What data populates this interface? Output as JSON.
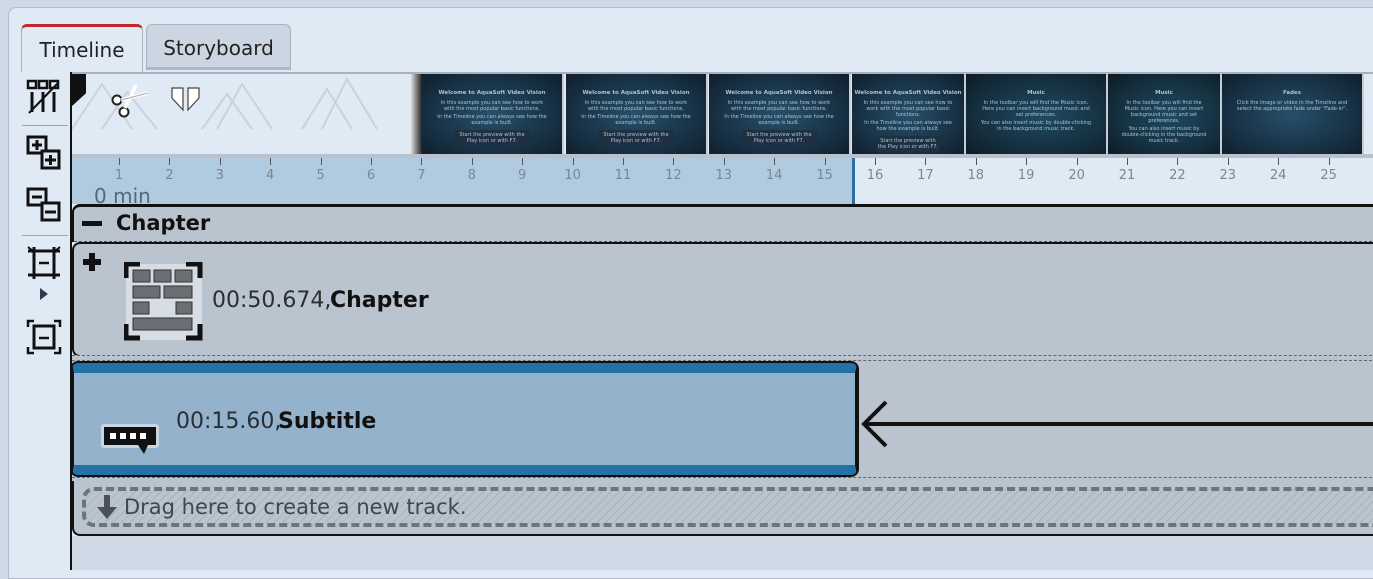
{
  "tabs": [
    {
      "label": "Timeline",
      "active": true
    },
    {
      "label": "Storyboard",
      "active": false
    }
  ],
  "toolstrip": [
    {
      "icon": "trim-tracks-icon"
    },
    {
      "icon": "expand-all-icon"
    },
    {
      "icon": "collapse-all-icon"
    },
    {
      "icon": "zoom-fit-icon"
    },
    {
      "icon": "play-marker-icon"
    },
    {
      "icon": "zoom-out-icon"
    }
  ],
  "toolbar_icons": [
    "scissors-icon",
    "split-marker-icon"
  ],
  "filmstrip": [
    {
      "title": "Welcome to AquaSoft Video Vision",
      "lines": [
        "In this example you can see how to work with the most popular basic functions.",
        "In the Timeline you can always see how the example is built."
      ],
      "box": "Start the preview with the Play icon or with F7."
    },
    {
      "title": "Welcome to AquaSoft Video Vision",
      "lines": [
        "In this example you can see how to work with the most popular basic functions.",
        "In the Timeline you can always see how the example is built."
      ],
      "box": "Start the preview with the Play icon or with F7."
    },
    {
      "title": "Welcome to AquaSoft Video Vision",
      "lines": [
        "In this example you can see how to work with the most popular basic functions.",
        "In the Timeline you can always see how the example is built."
      ],
      "box": "Start the preview with the Play icon or with F7."
    },
    {
      "title": "Welcome to AquaSoft Video Vision",
      "lines": [
        "In this example you can see how to work with the most popular basic functions.",
        "In the Timeline you can always see how the example is built."
      ],
      "box": "Start the preview with the Play icon or with F7."
    },
    {
      "title": "Music",
      "lines": [
        "In the toolbar you will find the Music icon. Here you can insert background music and set preferences.",
        "You can also insert music by double-clicking in the background music track."
      ],
      "box": ""
    },
    {
      "title": "Music",
      "lines": [
        "In the toolbar you will find the Music icon. Here you can insert background music and set preferences.",
        "You can also insert music by double-clicking in the background music track."
      ],
      "box": ""
    },
    {
      "title": "Fades",
      "lines": [
        "Click the image or video in the Timeline and select the appropriate fade under \"Fade-in\"."
      ],
      "box": ""
    }
  ],
  "ruler": {
    "ticks": [
      "1",
      "2",
      "3",
      "4",
      "5",
      "6",
      "7",
      "8",
      "9",
      "10",
      "11",
      "12",
      "13",
      "14",
      "15",
      "16",
      "17",
      "18",
      "19",
      "20",
      "21",
      "22",
      "23",
      "24",
      "25"
    ],
    "unit_label": "0 min",
    "selection_end_seconds": 15.6
  },
  "chapter": {
    "header_label": "Chapter",
    "duration": "00:50.674,",
    "name": "Chapter"
  },
  "subtitle": {
    "duration": "00:15.60,",
    "name": "Subtitle"
  },
  "new_track": {
    "label": "Drag here to create a new track."
  },
  "colors": {
    "active_tab_accent": "#c0282c",
    "clip_blue": "#2471a8",
    "clip_fill": "#94b2cb",
    "ruler_selection": "#b0cbe0"
  }
}
